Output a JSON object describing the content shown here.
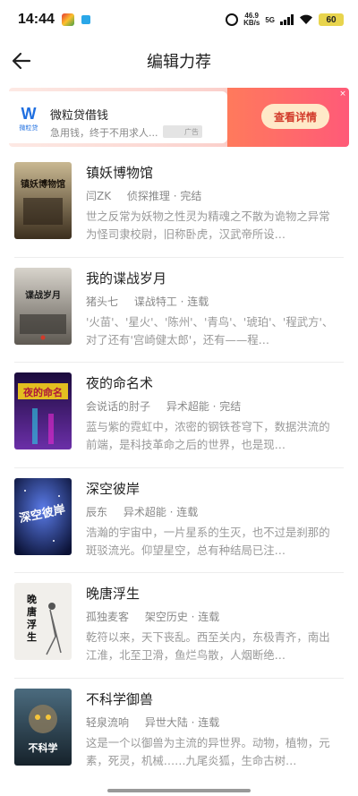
{
  "status_bar": {
    "time": "14:44",
    "net_speed_value": "46.9",
    "net_speed_unit": "KB/s",
    "net_type": "5G",
    "battery": "60"
  },
  "header": {
    "title": "编辑力荐",
    "back_icon": "arrow-left-icon"
  },
  "ad": {
    "logo_mark": "W",
    "logo_text": "微粒贷",
    "title": "微粒贷借钱",
    "subtitle": "急用钱，终于不用求人...",
    "badge": "广告",
    "cta": "查看详情",
    "close": "×",
    "accent": "#ff5a78"
  },
  "books": [
    {
      "title": "镇妖博物馆",
      "author": "闫ZK",
      "genre": "侦探推理 · 完结",
      "desc": "世之反常为妖物之性灵为精魂之不散为诡物之异常为怪司隶校尉，旧称卧虎，汉武帝所设…",
      "cover_color": "#6a5a3c"
    },
    {
      "title": "我的谍战岁月",
      "author": "猪头七",
      "genre": "谍战特工 · 连载",
      "desc": "'火苗'、'星火'、'陈州'、'青鸟'、'琥珀'、'程武方'、对了还有'宫崎健太郎'，还有——程…",
      "cover_color": "#8c8780"
    },
    {
      "title": "夜的命名术",
      "author": "会说话的肘子",
      "genre": "异术超能 · 完结",
      "desc": "蓝与紫的霓虹中，浓密的钢铁苍穹下，数据洪流的前端，是科技革命之后的世界，也是现…",
      "cover_color": "#3a1f6e"
    },
    {
      "title": "深空彼岸",
      "author": "辰东",
      "genre": "异术超能 · 连载",
      "desc": "浩瀚的宇宙中，一片星系的生灭，也不过是刹那的斑驳流光。仰望星空，总有种结局已注…",
      "cover_color": "#1c2a6b"
    },
    {
      "title": "晚唐浮生",
      "author": "孤独麦客",
      "genre": "架空历史 · 连载",
      "desc": "乾符以来，天下丧乱。西至关内，东极青齐，南出江淮，北至卫滑，鱼烂鸟散，人烟断绝…",
      "cover_color": "#e8e6e2"
    },
    {
      "title": "不科学御兽",
      "author": "轻泉流响",
      "genre": "异世大陆 · 连载",
      "desc": "这是一个以御兽为主流的异世界。动物，植物，元素，死灵，机械……九尾炎狐，生命古树…",
      "cover_color": "#2b4a5e"
    }
  ]
}
